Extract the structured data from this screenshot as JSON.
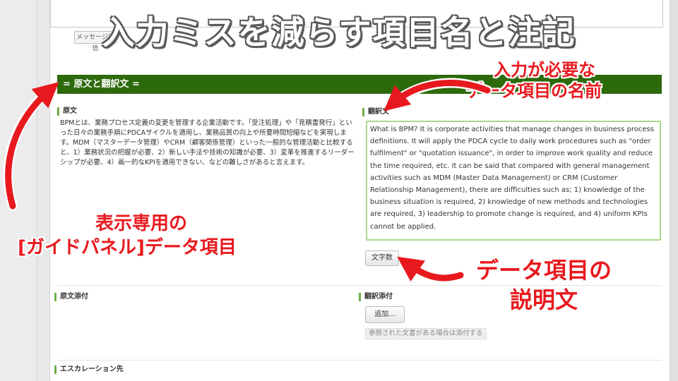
{
  "overlay": {
    "title": "入力ミスを減らす項目名と注記",
    "callout_field_name_line1": "入力が必要な",
    "callout_field_name_line2": "データ項目の名前",
    "callout_guide_line1": "表示専用の",
    "callout_guide_line2": "[ガイドパネル]データ項目",
    "callout_description_line1": "データ項目の",
    "callout_description_line2": "説明文"
  },
  "form": {
    "top_button_label": "メッセージ送信",
    "section_title": "= 原文と翻訳文 =",
    "source_label": "原文",
    "source_text": "BPMとは、業務プロセス定義の変更を管理する企業活動です。「受注処理」や「見積書発行」といった日々の業務手順にPDCAサイクルを適用し、業務品質の向上や所要時間短縮などを実現します。MDM（マスターデータ管理）やCRM（顧客関係管理）といった一般的な管理活動と比較すると、1）業務状況の把握が必要、2）新しい手法や技術の知識が必要、3）変革を推進するリーダーシップが必要、4）画一的なKPIを適用できない、などの難しさがあると言えます。",
    "translation_label": "翻訳文",
    "translation_text": "What is BPM? It is corporate activities that manage changes in business process definitions. It will apply the PDCA cycle to daily work procedures such as \"order fulfilment\" or \"quotation issuance\", in order to improve work quality and reduce the time required, etc. It can be said that compared with general management activities such as MDM (Master Data Management) or CRM (Customer Relationship Management), there are difficulties such as; 1) knowledge of the business situation is required, 2) knowledge of new methods and technologies are required, 3) leadership to promote change is required, and 4) uniform KPIs cannot be applied.",
    "char_count_button": "文字数",
    "source_attach_label": "原文添付",
    "translation_attach_label": "翻訳添付",
    "add_button": "追加...",
    "attach_hint": "参照された文書がある場合は添付する",
    "escalation_label": "エスカレーション先"
  },
  "colors": {
    "section_header_bg": "#2d6a0c",
    "label_accent": "#6fae49",
    "callout_red": "#e8191e"
  }
}
